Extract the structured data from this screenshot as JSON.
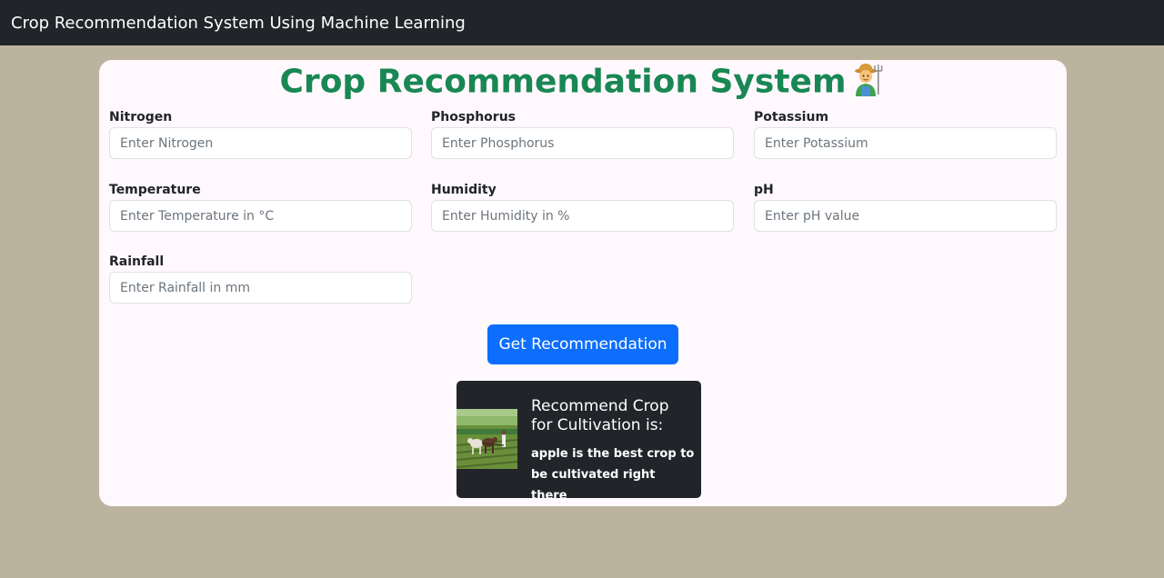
{
  "navbar": {
    "brand": "Crop Recommendation System Using Machine Learning"
  },
  "main": {
    "title": "Crop Recommendation System",
    "title_emoji": "farmer-emoji"
  },
  "form": {
    "fields": [
      {
        "label": "Nitrogen",
        "placeholder": "Enter Nitrogen",
        "value": ""
      },
      {
        "label": "Phosphorus",
        "placeholder": "Enter Phosphorus",
        "value": ""
      },
      {
        "label": "Potassium",
        "placeholder": "Enter Potassium",
        "value": ""
      },
      {
        "label": "Temperature",
        "placeholder": "Enter Temperature in °C",
        "value": ""
      },
      {
        "label": "Humidity",
        "placeholder": "Enter Humidity in %",
        "value": ""
      },
      {
        "label": "pH",
        "placeholder": "Enter pH value",
        "value": ""
      },
      {
        "label": "Rainfall",
        "placeholder": "Enter Rainfall in mm",
        "value": ""
      }
    ],
    "submit_label": "Get Recommendation"
  },
  "result": {
    "image": "farmer-plowing-field-image",
    "title": "Recommend Crop for Cultivation is:",
    "text": "apple is the best crop to be cultivated right there"
  },
  "colors": {
    "background": "#bcb39f",
    "navbar": "#212529",
    "title": "#198754",
    "button": "#0d6efd",
    "result_card": "#212529"
  }
}
